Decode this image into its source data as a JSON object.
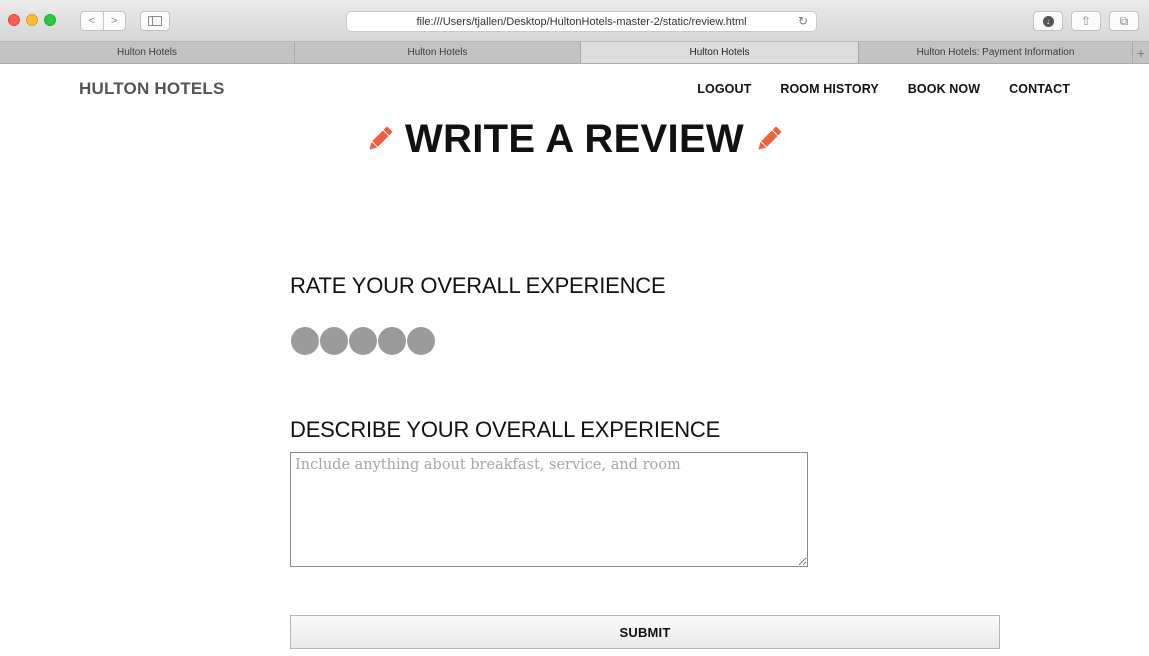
{
  "browser": {
    "url": "file:///Users/tjallen/Desktop/HultonHotels-master-2/static/review.html",
    "nav_back": "<",
    "nav_forward": ">",
    "reload_glyph": "↻",
    "download_glyph": "↓",
    "share_glyph": "⇧",
    "tabs_glyph": "⧉",
    "new_tab_glyph": "+",
    "tabs": [
      {
        "label": "Hulton Hotels",
        "active": false
      },
      {
        "label": "Hulton Hotels",
        "active": false
      },
      {
        "label": "Hulton Hotels",
        "active": true
      },
      {
        "label": "Hulton Hotels: Payment Information",
        "active": false
      }
    ]
  },
  "site": {
    "logo": "HULTON HOTELS",
    "nav": [
      "LOGOUT",
      "ROOM HISTORY",
      "BOOK NOW",
      "CONTACT"
    ]
  },
  "review": {
    "title": "WRITE A REVIEW",
    "rate_label": "RATE YOUR OVERALL EXPERIENCE",
    "rating_max": 5,
    "rating_value": 0,
    "describe_label": "DESCRIBE YOUR OVERALL EXPERIENCE",
    "textarea_value": "",
    "textarea_placeholder": "Include anything about breakfast, service, and room",
    "submit_label": "SUBMIT"
  },
  "colors": {
    "pencil_accent": "#f0603d",
    "rating_empty": "#9b9b9b"
  },
  "icons": {
    "title_icon": "pencil-icon"
  }
}
